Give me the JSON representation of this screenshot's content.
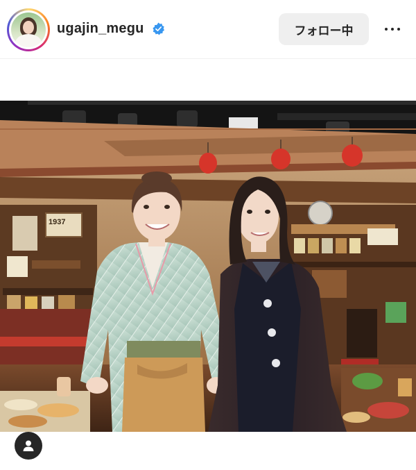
{
  "header": {
    "username": "ugajin_megu",
    "verified_icon": "verified-badge-icon",
    "follow_label": "フォロー中",
    "more_icon": "more-options-icon"
  },
  "post": {
    "image_sign": "1937",
    "tag_icon": "user-tag-icon"
  },
  "colors": {
    "verified": "#3897f0",
    "follow_button_bg": "#efefef",
    "text": "#262626"
  }
}
